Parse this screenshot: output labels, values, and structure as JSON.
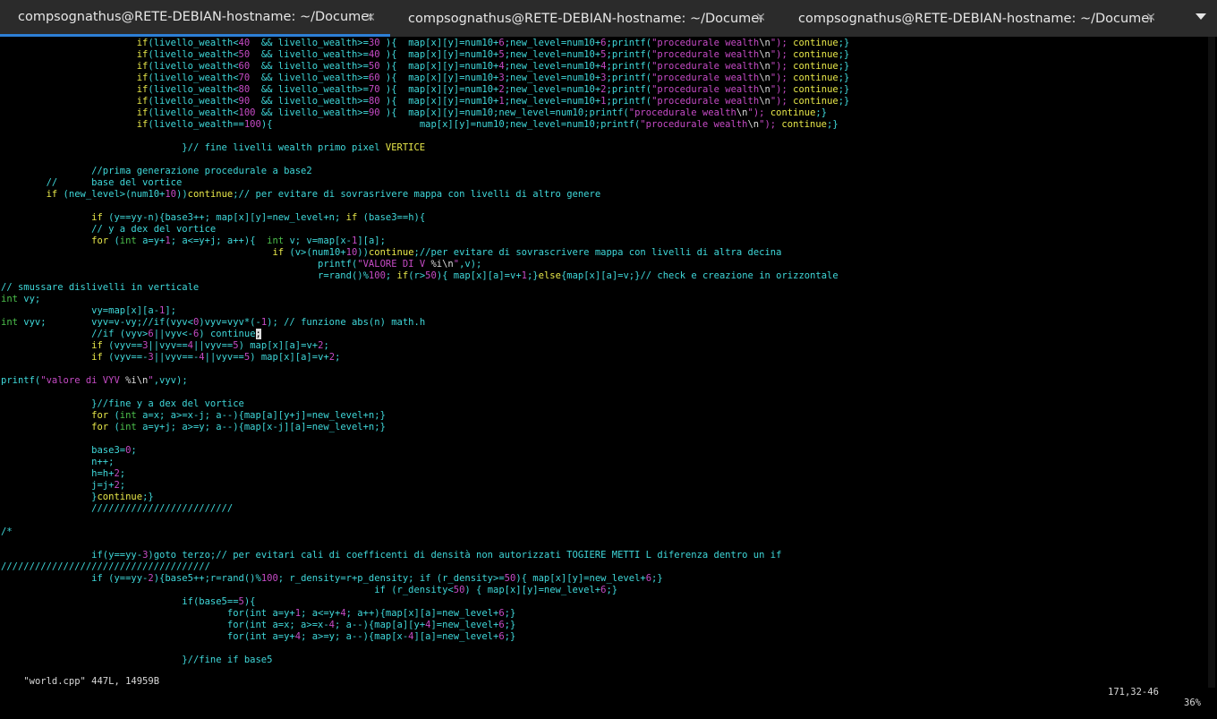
{
  "tabs": [
    {
      "title": "compsognathus@RETE-DEBIAN-hostname: ~/Documents",
      "close": "✕",
      "active": true
    },
    {
      "title": "compsognathus@RETE-DEBIAN-hostname: ~/Documents",
      "close": "✕",
      "active": false
    },
    {
      "title": "compsognathus@RETE-DEBIAN-hostname: ~/Documents",
      "close": "✕",
      "active": false
    }
  ],
  "colors": {
    "cyan": "#3fd8da",
    "magenta": "#c64bc6",
    "yellow": "#e8e84a",
    "green": "#4cc04c",
    "background": "#000000",
    "accent": "#2d7fd6"
  },
  "code_lines": [
    [
      [
        "                        ",
        ""
      ],
      [
        "if",
        "yl"
      ],
      [
        "(livello_wealth<",
        "cy"
      ],
      [
        "40",
        "mg"
      ],
      [
        "  && livello_wealth>=",
        "cy"
      ],
      [
        "30",
        "mg"
      ],
      [
        " ){  map[x][y]=num10+",
        "cy"
      ],
      [
        "6",
        "mg"
      ],
      [
        ";new_level=num10+",
        "cy"
      ],
      [
        "6",
        "mg"
      ],
      [
        ";printf(",
        "cy"
      ],
      [
        "\"procedurale wealth",
        "mg"
      ],
      [
        "\\n",
        "wh"
      ],
      [
        "\"); ",
        "mg"
      ],
      [
        "continue",
        "yl"
      ],
      [
        ";}",
        "cy"
      ]
    ],
    [
      [
        "                        ",
        ""
      ],
      [
        "if",
        "yl"
      ],
      [
        "(livello_wealth<",
        "cy"
      ],
      [
        "50",
        "mg"
      ],
      [
        "  && livello_wealth>=",
        "cy"
      ],
      [
        "40",
        "mg"
      ],
      [
        " ){  map[x][y]=num10+",
        "cy"
      ],
      [
        "5",
        "mg"
      ],
      [
        ";new_level=num10+",
        "cy"
      ],
      [
        "5",
        "mg"
      ],
      [
        ";printf(",
        "cy"
      ],
      [
        "\"procedurale wealth",
        "mg"
      ],
      [
        "\\n",
        "wh"
      ],
      [
        "\"); ",
        "mg"
      ],
      [
        "continue",
        "yl"
      ],
      [
        ";}",
        "cy"
      ]
    ],
    [
      [
        "                        ",
        ""
      ],
      [
        "if",
        "yl"
      ],
      [
        "(livello_wealth<",
        "cy"
      ],
      [
        "60",
        "mg"
      ],
      [
        "  && livello_wealth>=",
        "cy"
      ],
      [
        "50",
        "mg"
      ],
      [
        " ){  map[x][y]=num10+",
        "cy"
      ],
      [
        "4",
        "mg"
      ],
      [
        ";new_level=num10+",
        "cy"
      ],
      [
        "4",
        "mg"
      ],
      [
        ";printf(",
        "cy"
      ],
      [
        "\"procedurale wealth",
        "mg"
      ],
      [
        "\\n",
        "wh"
      ],
      [
        "\"); ",
        "mg"
      ],
      [
        "continue",
        "yl"
      ],
      [
        ";}",
        "cy"
      ]
    ],
    [
      [
        "                        ",
        ""
      ],
      [
        "if",
        "yl"
      ],
      [
        "(livello_wealth<",
        "cy"
      ],
      [
        "70",
        "mg"
      ],
      [
        "  && livello_wealth>=",
        "cy"
      ],
      [
        "60",
        "mg"
      ],
      [
        " ){  map[x][y]=num10+",
        "cy"
      ],
      [
        "3",
        "mg"
      ],
      [
        ";new_level=num10+",
        "cy"
      ],
      [
        "3",
        "mg"
      ],
      [
        ";printf(",
        "cy"
      ],
      [
        "\"procedurale wealth",
        "mg"
      ],
      [
        "\\n",
        "wh"
      ],
      [
        "\"); ",
        "mg"
      ],
      [
        "continue",
        "yl"
      ],
      [
        ";}",
        "cy"
      ]
    ],
    [
      [
        "                        ",
        ""
      ],
      [
        "if",
        "yl"
      ],
      [
        "(livello_wealth<",
        "cy"
      ],
      [
        "80",
        "mg"
      ],
      [
        "  && livello_wealth>=",
        "cy"
      ],
      [
        "70",
        "mg"
      ],
      [
        " ){  map[x][y]=num10+",
        "cy"
      ],
      [
        "2",
        "mg"
      ],
      [
        ";new_level=num10+",
        "cy"
      ],
      [
        "2",
        "mg"
      ],
      [
        ";printf(",
        "cy"
      ],
      [
        "\"procedurale wealth",
        "mg"
      ],
      [
        "\\n",
        "wh"
      ],
      [
        "\"); ",
        "mg"
      ],
      [
        "continue",
        "yl"
      ],
      [
        ";}",
        "cy"
      ]
    ],
    [
      [
        "                        ",
        ""
      ],
      [
        "if",
        "yl"
      ],
      [
        "(livello_wealth<",
        "cy"
      ],
      [
        "90",
        "mg"
      ],
      [
        "  && livello_wealth>=",
        "cy"
      ],
      [
        "80",
        "mg"
      ],
      [
        " ){  map[x][y]=num10+",
        "cy"
      ],
      [
        "1",
        "mg"
      ],
      [
        ";new_level=num10+",
        "cy"
      ],
      [
        "1",
        "mg"
      ],
      [
        ";printf(",
        "cy"
      ],
      [
        "\"procedurale wealth",
        "mg"
      ],
      [
        "\\n",
        "wh"
      ],
      [
        "\"); ",
        "mg"
      ],
      [
        "continue",
        "yl"
      ],
      [
        ";}",
        "cy"
      ]
    ],
    [
      [
        "                        ",
        ""
      ],
      [
        "if",
        "yl"
      ],
      [
        "(livello_wealth<",
        "cy"
      ],
      [
        "100",
        "mg"
      ],
      [
        " && livello_wealth>=",
        "cy"
      ],
      [
        "90",
        "mg"
      ],
      [
        " ){  map[x][y]=num10;new_level=num10;printf(",
        "cy"
      ],
      [
        "\"procedurale wealth",
        "mg"
      ],
      [
        "\\n",
        "wh"
      ],
      [
        "\"); ",
        "mg"
      ],
      [
        "continue",
        "yl"
      ],
      [
        ";}",
        "cy"
      ]
    ],
    [
      [
        "                        ",
        ""
      ],
      [
        "if",
        "yl"
      ],
      [
        "(livello_wealth==",
        "cy"
      ],
      [
        "100",
        "mg"
      ],
      [
        "){                          map[x][y]=num10;new_level=num10;printf(",
        "cy"
      ],
      [
        "\"procedurale wealth",
        "mg"
      ],
      [
        "\\n",
        "wh"
      ],
      [
        "\"); ",
        "mg"
      ],
      [
        "continue",
        "yl"
      ],
      [
        ";}",
        "cy"
      ]
    ],
    [],
    [
      [
        "                                ",
        ""
      ],
      [
        "}// fine livelli wealth primo pixel ",
        "cy"
      ],
      [
        "VERTICE",
        "yl"
      ]
    ],
    [],
    [
      [
        "                ",
        ""
      ],
      [
        "//prima generazione procedurale a base2",
        "cy"
      ]
    ],
    [
      [
        "        ",
        ""
      ],
      [
        "//      base del vortice",
        "cy"
      ]
    ],
    [
      [
        "        ",
        ""
      ],
      [
        "if",
        "yl"
      ],
      [
        " (new_level>(num10+",
        "cy"
      ],
      [
        "10",
        "mg"
      ],
      [
        "))",
        "cy"
      ],
      [
        "continue",
        "yl"
      ],
      [
        ";// per evitare di sovrasrivere mappa con livelli di altro genere",
        "cy"
      ]
    ],
    [],
    [
      [
        "                ",
        ""
      ],
      [
        "if",
        "yl"
      ],
      [
        " (y==yy-n){base3++; map[x][y]=new_level+n; ",
        "cy"
      ],
      [
        "if",
        "yl"
      ],
      [
        " (base3==h){",
        "cy"
      ]
    ],
    [
      [
        "                ",
        ""
      ],
      [
        "// y a dex del vortice",
        "cy"
      ]
    ],
    [
      [
        "                ",
        ""
      ],
      [
        "for",
        "yl"
      ],
      [
        " (",
        "cy"
      ],
      [
        "int",
        "gr"
      ],
      [
        " a=y+",
        "cy"
      ],
      [
        "1",
        "mg"
      ],
      [
        "; a<=y+j; a++){  ",
        "cy"
      ],
      [
        "int",
        "gr"
      ],
      [
        " v; v=map[x-",
        "cy"
      ],
      [
        "1",
        "mg"
      ],
      [
        "][a];",
        "cy"
      ]
    ],
    [
      [
        "                                                ",
        ""
      ],
      [
        "if",
        "yl"
      ],
      [
        " (v>(num10+",
        "cy"
      ],
      [
        "10",
        "mg"
      ],
      [
        "))",
        "cy"
      ],
      [
        "continue",
        "yl"
      ],
      [
        ";//per evitare di sovrascrivere mappa con livelli di altra decina",
        "cy"
      ]
    ],
    [
      [
        "                                                        ",
        ""
      ],
      [
        "printf(",
        "cy"
      ],
      [
        "\"VALORE DI V ",
        "mg"
      ],
      [
        "%i\\n",
        "wh"
      ],
      [
        "\"",
        "mg"
      ],
      [
        ",v);",
        "cy"
      ]
    ],
    [
      [
        "                                                        ",
        ""
      ],
      [
        "r=rand()%",
        "cy"
      ],
      [
        "100",
        "mg"
      ],
      [
        "; ",
        "cy"
      ],
      [
        "if",
        "yl"
      ],
      [
        "(r>",
        "cy"
      ],
      [
        "50",
        "mg"
      ],
      [
        "){ map[x][a]=v+",
        "cy"
      ],
      [
        "1",
        "mg"
      ],
      [
        ";}",
        "cy"
      ],
      [
        "else",
        "yl"
      ],
      [
        "{map[x][a]=v;}// check e creazione in orizzontale",
        "cy"
      ]
    ],
    [
      [
        "// smussare dislivelli in verticale",
        "cy"
      ]
    ],
    [
      [
        "int",
        "gr"
      ],
      [
        " vy;",
        "cy"
      ]
    ],
    [
      [
        "                ",
        ""
      ],
      [
        "vy=map[x][a-",
        "cy"
      ],
      [
        "1",
        "mg"
      ],
      [
        "];",
        "cy"
      ]
    ],
    [
      [
        "int",
        "gr"
      ],
      [
        " vyv;        vyv=v-vy;//if(vyv<",
        "cy"
      ],
      [
        "0",
        "mg"
      ],
      [
        ")vyv=vyv*(-",
        "cy"
      ],
      [
        "1",
        "mg"
      ],
      [
        "); // funzione abs(n) math.h",
        "cy"
      ]
    ],
    [
      [
        "                ",
        ""
      ],
      [
        "//if (vyv>",
        "cy"
      ],
      [
        "6",
        "mg"
      ],
      [
        "||vyv<-",
        "cy"
      ],
      [
        "6",
        "mg"
      ],
      [
        ") continue",
        "cy"
      ],
      [
        ";",
        "cur"
      ]
    ],
    [
      [
        "                ",
        ""
      ],
      [
        "if",
        "yl"
      ],
      [
        " (vyv==",
        "cy"
      ],
      [
        "3",
        "mg"
      ],
      [
        "||vyv==",
        "cy"
      ],
      [
        "4",
        "mg"
      ],
      [
        "||vyv==",
        "cy"
      ],
      [
        "5",
        "mg"
      ],
      [
        ") map[x][a]=v+",
        "cy"
      ],
      [
        "2",
        "mg"
      ],
      [
        ";",
        "cy"
      ]
    ],
    [
      [
        "                ",
        ""
      ],
      [
        "if",
        "yl"
      ],
      [
        " (vyv==-",
        "cy"
      ],
      [
        "3",
        "mg"
      ],
      [
        "||vyv==-",
        "cy"
      ],
      [
        "4",
        "mg"
      ],
      [
        "||vyv==",
        "cy"
      ],
      [
        "5",
        "mg"
      ],
      [
        ") map[x][a]=v+",
        "cy"
      ],
      [
        "2",
        "mg"
      ],
      [
        ";",
        "cy"
      ]
    ],
    [],
    [
      [
        "printf(",
        "cy"
      ],
      [
        "\"valore di VYV ",
        "mg"
      ],
      [
        "%i\\n",
        "wh"
      ],
      [
        "\"",
        "mg"
      ],
      [
        ",vyv);",
        "cy"
      ]
    ],
    [],
    [
      [
        "                ",
        ""
      ],
      [
        "}//fine y a dex del vortice",
        "cy"
      ]
    ],
    [
      [
        "                ",
        ""
      ],
      [
        "for",
        "yl"
      ],
      [
        " (",
        "cy"
      ],
      [
        "int",
        "gr"
      ],
      [
        " a=x; a>=x-j; a--){map[a][y+j]=new_level+n;}",
        "cy"
      ]
    ],
    [
      [
        "                ",
        ""
      ],
      [
        "for",
        "yl"
      ],
      [
        " (",
        "cy"
      ],
      [
        "int",
        "gr"
      ],
      [
        " a=y+j; a>=y; a--){map[x-j][a]=new_level+n;}",
        "cy"
      ]
    ],
    [],
    [
      [
        "                ",
        ""
      ],
      [
        "base3=",
        "cy"
      ],
      [
        "0",
        "mg"
      ],
      [
        ";",
        "cy"
      ]
    ],
    [
      [
        "                ",
        ""
      ],
      [
        "n++;",
        "cy"
      ]
    ],
    [
      [
        "                ",
        ""
      ],
      [
        "h=h+",
        "cy"
      ],
      [
        "2",
        "mg"
      ],
      [
        ";",
        "cy"
      ]
    ],
    [
      [
        "                ",
        ""
      ],
      [
        "j=j+",
        "cy"
      ],
      [
        "2",
        "mg"
      ],
      [
        ";",
        "cy"
      ]
    ],
    [
      [
        "                ",
        ""
      ],
      [
        "}",
        "cy"
      ],
      [
        "continue",
        "yl"
      ],
      [
        ";}",
        "cy"
      ]
    ],
    [
      [
        "                ",
        ""
      ],
      [
        "/////////////////////////",
        "cy"
      ]
    ],
    [],
    [
      [
        "/*",
        "cy"
      ]
    ],
    [],
    [
      [
        "                ",
        ""
      ],
      [
        "if(y==yy-",
        "cy"
      ],
      [
        "3",
        "mg"
      ],
      [
        ")goto terzo;// per evitari cali di coefficenti di densità non autorizzati TOGIERE METTI L diferenza dentro un if",
        "cy"
      ]
    ],
    [
      [
        "/////////////////////////////////////",
        "cy"
      ]
    ],
    [
      [
        "                ",
        ""
      ],
      [
        "if (y==yy-",
        "cy"
      ],
      [
        "2",
        "mg"
      ],
      [
        "){base5++;r=rand()%",
        "cy"
      ],
      [
        "100",
        "mg"
      ],
      [
        "; r_density=r+p_density; if (r_density>=",
        "cy"
      ],
      [
        "50",
        "mg"
      ],
      [
        "){ map[x][y]=new_level+",
        "cy"
      ],
      [
        "6",
        "mg"
      ],
      [
        ";}",
        "cy"
      ]
    ],
    [
      [
        "                                                                  ",
        ""
      ],
      [
        "if (r_density<",
        "cy"
      ],
      [
        "50",
        "mg"
      ],
      [
        ") { map[x][y]=new_level+",
        "cy"
      ],
      [
        "6",
        "mg"
      ],
      [
        ";}",
        "cy"
      ]
    ],
    [
      [
        "                                ",
        ""
      ],
      [
        "if(base5==",
        "cy"
      ],
      [
        "5",
        "mg"
      ],
      [
        "){",
        "cy"
      ]
    ],
    [
      [
        "                                        ",
        ""
      ],
      [
        "for(int a=y+",
        "cy"
      ],
      [
        "1",
        "mg"
      ],
      [
        "; a<=y+",
        "cy"
      ],
      [
        "4",
        "mg"
      ],
      [
        "; a++){map[x][a]=new_level+",
        "cy"
      ],
      [
        "6",
        "mg"
      ],
      [
        ";}",
        "cy"
      ]
    ],
    [
      [
        "                                        ",
        ""
      ],
      [
        "for(int a=x; a>=x-",
        "cy"
      ],
      [
        "4",
        "mg"
      ],
      [
        "; a--){map[a][y+",
        "cy"
      ],
      [
        "4",
        "mg"
      ],
      [
        "]=new_level+",
        "cy"
      ],
      [
        "6",
        "mg"
      ],
      [
        ";}",
        "cy"
      ]
    ],
    [
      [
        "                                        ",
        ""
      ],
      [
        "for(int a=y+",
        "cy"
      ],
      [
        "4",
        "mg"
      ],
      [
        "; a>=y; a--){map[x-",
        "cy"
      ],
      [
        "4",
        "mg"
      ],
      [
        "][a]=new_level+",
        "cy"
      ],
      [
        "6",
        "mg"
      ],
      [
        ";}",
        "cy"
      ]
    ],
    [],
    [
      [
        "                                ",
        ""
      ],
      [
        "}//fine if base5",
        "cy"
      ]
    ]
  ],
  "status": {
    "file": "\"world.cpp\" 447L, 14959B",
    "position": "171,32-46",
    "percent": "36%"
  }
}
